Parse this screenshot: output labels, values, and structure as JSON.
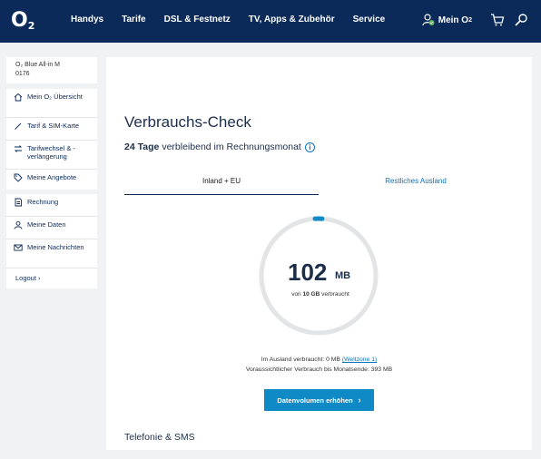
{
  "header": {
    "logo": "O",
    "logo_sub": "2",
    "nav": [
      "Handys",
      "Tarife",
      "DSL & Festnetz",
      "TV, Apps & Zubehör",
      "Service"
    ],
    "mein_o2": "Mein O",
    "mein_o2_sub": "2"
  },
  "account": {
    "tariff": "O₂ Blue All-in M",
    "number": "0176"
  },
  "sidebar": {
    "group1": [
      {
        "label": "Mein O₂ Übersicht",
        "icon": "home-icon"
      },
      {
        "label": "Tarif & SIM-Karte",
        "icon": "pencil-icon"
      },
      {
        "label": "Tarifwechsel & -verlängerung",
        "icon": "exchange-icon"
      },
      {
        "label": "Meine Angebote",
        "icon": "tag-icon"
      }
    ],
    "group2": [
      {
        "label": "Rechnung",
        "icon": "invoice-icon"
      },
      {
        "label": "Meine Daten",
        "icon": "user-icon"
      },
      {
        "label": "Meine Nachrichten",
        "icon": "mail-icon"
      }
    ],
    "logout": "Logout ›"
  },
  "main": {
    "title": "Verbrauchs-Check",
    "remaining_bold": "24 Tage",
    "remaining_rest": "verbleibend im Rechnungsmonat",
    "tabs": [
      "Inland + EU",
      "Restliches Ausland"
    ],
    "usage_value": "102",
    "usage_unit": "MB",
    "usage_of_prefix": "von",
    "usage_of_amount": "10 GB",
    "usage_of_suffix": "verbraucht",
    "usage_fraction": 0.0102,
    "abroad_text": "Im Ausland verbraucht: 0 MB",
    "abroad_link": "(Weltzone 1)",
    "forecast": "Voraussichtlicher Verbrauch bis Monatsende: 393 MB",
    "cta": "Datenvolumen erhöhen",
    "cta_arrow": "›",
    "section_title": "Telefonie & SMS"
  },
  "colors": {
    "header_bg": "#0b2a59",
    "accent": "#0f8ac7",
    "gauge_track": "#e3e4e6"
  }
}
